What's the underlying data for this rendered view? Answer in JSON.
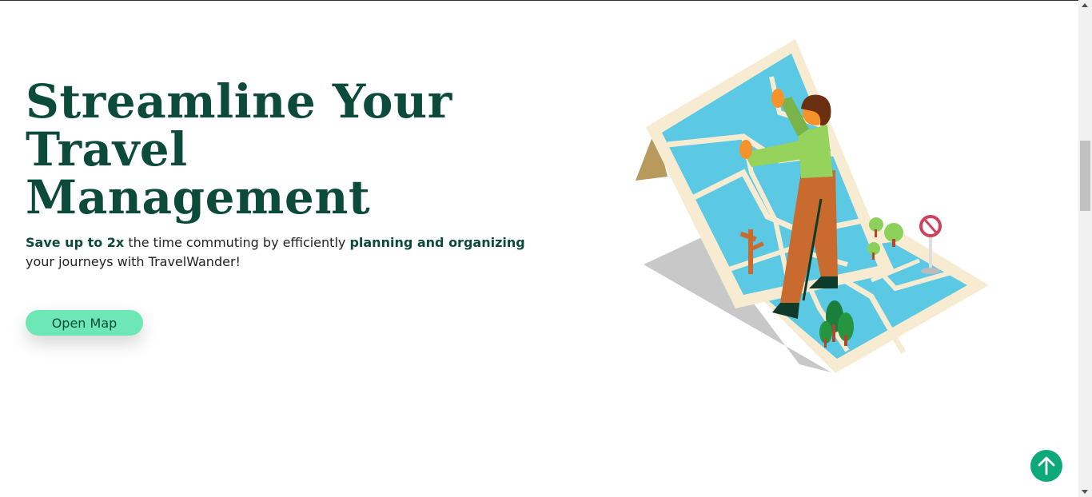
{
  "hero": {
    "title_lines": [
      "Streamline Your",
      "Travel",
      "Management"
    ],
    "text": {
      "part1_bold": "Save up to 2x",
      "part2": " the time commuting by efficiently ",
      "part3_bold": "planning and organizing",
      "part4": " your journeys with TravelWander!"
    },
    "button_label": "Open Map"
  },
  "illustration": {
    "name": "person-reading-giant-map-illustration"
  },
  "scroll_top": {
    "icon": "arrow-up-icon"
  },
  "colors": {
    "title": "#0c4a3a",
    "button_bg": "#6ee7b7",
    "scroll_top_bg": "#0ea97a",
    "map_water": "#5bc8e4",
    "map_paper": "#f7ecd2"
  }
}
